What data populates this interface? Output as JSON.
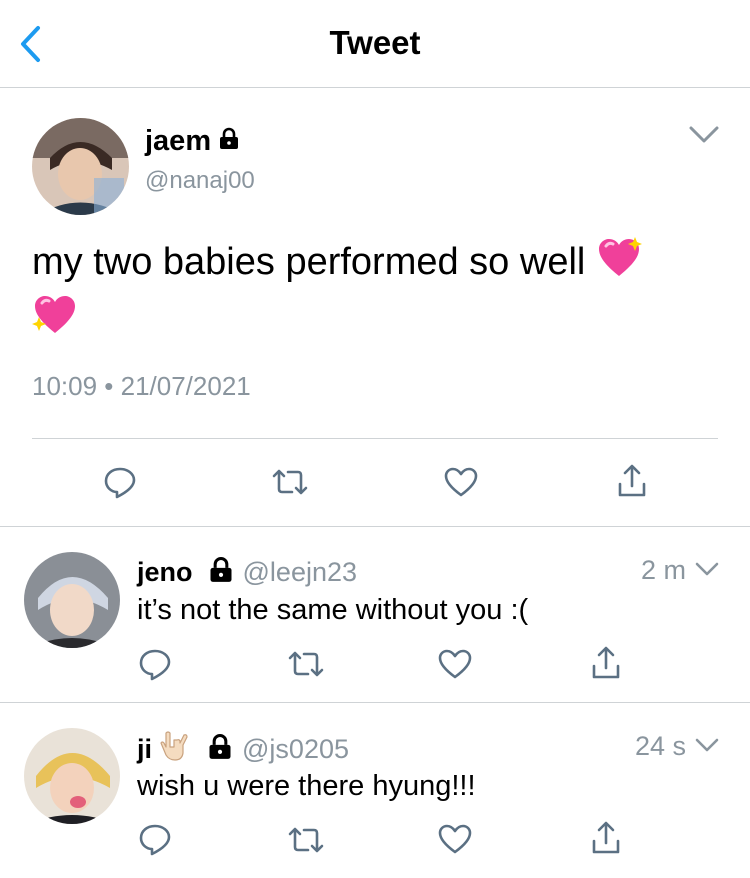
{
  "header": {
    "title": "Tweet"
  },
  "tweet": {
    "name": "jaem",
    "handle": "@nanaj00",
    "text": "my two babies performed so well",
    "timestamp": "10:09 • 21/07/2021"
  },
  "replies": [
    {
      "name": "jeno",
      "handle": "@leejn23",
      "time": "2 m",
      "text": "it’s not the same without you :("
    },
    {
      "name": "ji",
      "handle": "@js0205",
      "time": "24 s",
      "text": "wish u were there hyung!!!"
    }
  ],
  "icons": {
    "back": "chevron-left-icon",
    "lock": "lock-icon",
    "caret": "chevron-down-icon",
    "emoji": "sparkling-heart-icon",
    "hand": "love-you-gesture-icon",
    "reply": "reply-icon",
    "retweet": "retweet-icon",
    "like": "heart-icon",
    "share": "share-icon"
  },
  "colors": {
    "accent": "#1d9bf0",
    "secondary_text": "#8a959e",
    "divider": "#cfd3d6",
    "icon": "#5b7083"
  }
}
